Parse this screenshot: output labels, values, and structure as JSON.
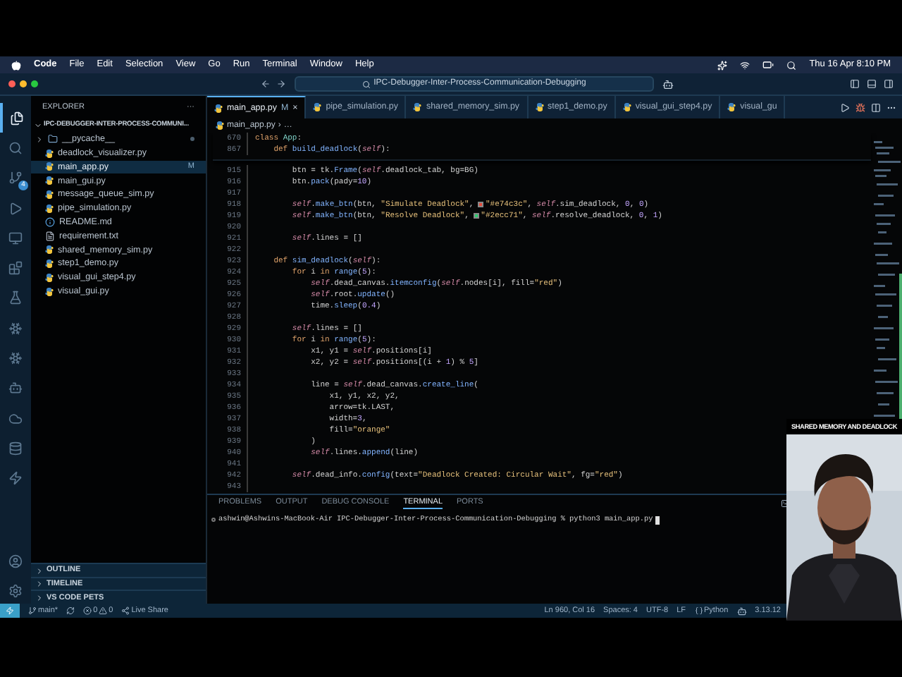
{
  "menu_bar": {
    "app": "Code",
    "items": [
      "File",
      "Edit",
      "Selection",
      "View",
      "Go",
      "Run",
      "Terminal",
      "Window",
      "Help"
    ],
    "clock": "Thu 16 Apr 8:10 PM"
  },
  "title_bar": {
    "search": "IPC-Debugger-Inter-Process-Communication-Debugging"
  },
  "activity_bar": {
    "items": [
      {
        "selected": true
      },
      {
        "selected": false
      },
      {
        "selected": false,
        "badge": "4"
      },
      {
        "selected": false
      },
      {
        "selected": false
      },
      {
        "selected": false
      },
      {
        "selected": false
      },
      {
        "selected": false
      },
      {
        "selected": false
      },
      {
        "selected": false
      },
      {
        "selected": false
      },
      {
        "selected": false
      },
      {
        "selected": false
      }
    ]
  },
  "sidebar": {
    "title": "EXPLORER",
    "more": "···",
    "folder": {
      "name": "IPC-DEBUGGER-INTER-PROCESS-COMMUNI...",
      "expanded": true
    },
    "files": [
      {
        "name": "__pycache__",
        "kind": "folder",
        "selected": false,
        "dot": true
      },
      {
        "name": "deadlock_visualizer.py",
        "kind": "py",
        "selected": false
      },
      {
        "name": "main_app.py",
        "kind": "py",
        "selected": true,
        "badge": "M"
      },
      {
        "name": "main_gui.py",
        "kind": "py",
        "selected": false
      },
      {
        "name": "message_queue_sim.py",
        "kind": "py",
        "selected": false
      },
      {
        "name": "pipe_simulation.py",
        "kind": "py",
        "selected": false
      },
      {
        "name": "README.md",
        "kind": "md",
        "selected": false
      },
      {
        "name": "requirement.txt",
        "kind": "txt",
        "selected": false
      },
      {
        "name": "shared_memory_sim.py",
        "kind": "py",
        "selected": false
      },
      {
        "name": "step1_demo.py",
        "kind": "py",
        "selected": false
      },
      {
        "name": "visual_gui_step4.py",
        "kind": "py",
        "selected": false
      },
      {
        "name": "visual_gui.py",
        "kind": "py",
        "selected": false
      }
    ],
    "sections": [
      "OUTLINE",
      "TIMELINE",
      "VS CODE PETS"
    ]
  },
  "tabs": [
    {
      "label": "main_app.py",
      "selected": true,
      "badge": "M",
      "close": "×"
    },
    {
      "label": "pipe_simulation.py",
      "selected": false
    },
    {
      "label": "shared_memory_sim.py",
      "selected": false
    },
    {
      "label": "step1_demo.py",
      "selected": false
    },
    {
      "label": "visual_gui_step4.py",
      "selected": false
    },
    {
      "label": "visual_gu",
      "selected": false
    }
  ],
  "breadcrumb": {
    "file": "main_app.py",
    "separator": "›",
    "rest": "…"
  },
  "sticky": [
    {
      "num": "670",
      "tokens": [
        {
          "kind": "kw",
          "text": "class "
        },
        {
          "kind": "cls",
          "text": "App"
        },
        {
          "kind": "plain",
          "text": ":"
        }
      ]
    },
    {
      "num": "867",
      "tokens": [
        {
          "kind": "kw",
          "text": "    def "
        },
        {
          "kind": "fn",
          "text": "build_deadlock"
        },
        {
          "kind": "plain",
          "text": "("
        },
        {
          "kind": "self",
          "text": "self"
        },
        {
          "kind": "plain",
          "text": "):"
        }
      ]
    }
  ],
  "code": [
    {
      "num": "915",
      "tokens": [
        {
          "kind": "plain",
          "text": "        btn = tk."
        },
        {
          "kind": "fn",
          "text": "Frame"
        },
        {
          "kind": "plain",
          "text": "("
        },
        {
          "kind": "self",
          "text": "self"
        },
        {
          "kind": "plain",
          "text": ".deadlock_tab, bg=BG)"
        }
      ]
    },
    {
      "num": "916",
      "tokens": [
        {
          "kind": "plain",
          "text": "        btn."
        },
        {
          "kind": "fn",
          "text": "pack"
        },
        {
          "kind": "plain",
          "text": "(pady="
        },
        {
          "kind": "num",
          "text": "10"
        },
        {
          "kind": "plain",
          "text": ")"
        }
      ]
    },
    {
      "num": "917"
    },
    {
      "num": "918",
      "tokens": [
        {
          "kind": "self",
          "text": "        self"
        },
        {
          "kind": "plain",
          "text": "."
        },
        {
          "kind": "fn",
          "text": "make_btn"
        },
        {
          "kind": "plain",
          "text": "(btn, "
        },
        {
          "kind": "str",
          "text": "\"Simulate Deadlock\""
        },
        {
          "kind": "plain",
          "text": ", "
        },
        {
          "kind": "swatch",
          "color": "#e74c3c"
        },
        {
          "kind": "str",
          "text": "\"#e74c3c\""
        },
        {
          "kind": "plain",
          "text": ", "
        },
        {
          "kind": "self",
          "text": "self"
        },
        {
          "kind": "plain",
          "text": ".sim_deadlock, "
        },
        {
          "kind": "num",
          "text": "0"
        },
        {
          "kind": "plain",
          "text": ", "
        },
        {
          "kind": "num",
          "text": "0"
        },
        {
          "kind": "plain",
          "text": ")"
        }
      ]
    },
    {
      "num": "919",
      "tokens": [
        {
          "kind": "self",
          "text": "        self"
        },
        {
          "kind": "plain",
          "text": "."
        },
        {
          "kind": "fn",
          "text": "make_btn"
        },
        {
          "kind": "plain",
          "text": "(btn, "
        },
        {
          "kind": "str",
          "text": "\"Resolve Deadlock\""
        },
        {
          "kind": "plain",
          "text": ", "
        },
        {
          "kind": "swatch",
          "color": "#2ecc71"
        },
        {
          "kind": "str",
          "text": "\"#2ecc71\""
        },
        {
          "kind": "plain",
          "text": ", "
        },
        {
          "kind": "self",
          "text": "self"
        },
        {
          "kind": "plain",
          "text": ".resolve_deadlock, "
        },
        {
          "kind": "num",
          "text": "0"
        },
        {
          "kind": "plain",
          "text": ", "
        },
        {
          "kind": "num",
          "text": "1"
        },
        {
          "kind": "plain",
          "text": ")"
        }
      ]
    },
    {
      "num": "920"
    },
    {
      "num": "921",
      "tokens": [
        {
          "kind": "self",
          "text": "        self"
        },
        {
          "kind": "plain",
          "text": ".lines = []"
        }
      ]
    },
    {
      "num": "922"
    },
    {
      "num": "923",
      "tokens": [
        {
          "kind": "kw",
          "text": "    def "
        },
        {
          "kind": "fn",
          "text": "sim_deadlock"
        },
        {
          "kind": "plain",
          "text": "("
        },
        {
          "kind": "self",
          "text": "self"
        },
        {
          "kind": "plain",
          "text": "):"
        }
      ]
    },
    {
      "num": "924",
      "tokens": [
        {
          "kind": "kw",
          "text": "        for "
        },
        {
          "kind": "plain",
          "text": "i "
        },
        {
          "kind": "kw",
          "text": "in "
        },
        {
          "kind": "fn",
          "text": "range"
        },
        {
          "kind": "plain",
          "text": "("
        },
        {
          "kind": "num",
          "text": "5"
        },
        {
          "kind": "plain",
          "text": "):"
        }
      ]
    },
    {
      "num": "925",
      "tokens": [
        {
          "kind": "self",
          "text": "            self"
        },
        {
          "kind": "plain",
          "text": ".dead_canvas."
        },
        {
          "kind": "fn",
          "text": "itemconfig"
        },
        {
          "kind": "plain",
          "text": "("
        },
        {
          "kind": "self",
          "text": "self"
        },
        {
          "kind": "plain",
          "text": ".nodes[i], fill="
        },
        {
          "kind": "str",
          "text": "\"red\""
        },
        {
          "kind": "plain",
          "text": ")"
        }
      ]
    },
    {
      "num": "926",
      "tokens": [
        {
          "kind": "self",
          "text": "            self"
        },
        {
          "kind": "plain",
          "text": ".root."
        },
        {
          "kind": "fn",
          "text": "update"
        },
        {
          "kind": "plain",
          "text": "()"
        }
      ]
    },
    {
      "num": "927",
      "tokens": [
        {
          "kind": "plain",
          "text": "            time."
        },
        {
          "kind": "fn",
          "text": "sleep"
        },
        {
          "kind": "plain",
          "text": "("
        },
        {
          "kind": "num",
          "text": "0.4"
        },
        {
          "kind": "plain",
          "text": ")"
        }
      ]
    },
    {
      "num": "928"
    },
    {
      "num": "929",
      "tokens": [
        {
          "kind": "self",
          "text": "        self"
        },
        {
          "kind": "plain",
          "text": ".lines = []"
        }
      ]
    },
    {
      "num": "930",
      "tokens": [
        {
          "kind": "kw",
          "text": "        for "
        },
        {
          "kind": "plain",
          "text": "i "
        },
        {
          "kind": "kw",
          "text": "in "
        },
        {
          "kind": "fn",
          "text": "range"
        },
        {
          "kind": "plain",
          "text": "("
        },
        {
          "kind": "num",
          "text": "5"
        },
        {
          "kind": "plain",
          "text": "):"
        }
      ]
    },
    {
      "num": "931",
      "tokens": [
        {
          "kind": "plain",
          "text": "            x1, y1 = "
        },
        {
          "kind": "self",
          "text": "self"
        },
        {
          "kind": "plain",
          "text": ".positions[i]"
        }
      ]
    },
    {
      "num": "932",
      "tokens": [
        {
          "kind": "plain",
          "text": "            x2, y2 = "
        },
        {
          "kind": "self",
          "text": "self"
        },
        {
          "kind": "plain",
          "text": ".positions[(i + "
        },
        {
          "kind": "num",
          "text": "1"
        },
        {
          "kind": "plain",
          "text": ") % "
        },
        {
          "kind": "num",
          "text": "5"
        },
        {
          "kind": "plain",
          "text": "]"
        }
      ]
    },
    {
      "num": "933"
    },
    {
      "num": "934",
      "tokens": [
        {
          "kind": "plain",
          "text": "            line = "
        },
        {
          "kind": "self",
          "text": "self"
        },
        {
          "kind": "plain",
          "text": ".dead_canvas."
        },
        {
          "kind": "fn",
          "text": "create_line"
        },
        {
          "kind": "plain",
          "text": "("
        }
      ]
    },
    {
      "num": "935",
      "tokens": [
        {
          "kind": "plain",
          "text": "                x1, y1, x2, y2,"
        }
      ]
    },
    {
      "num": "936",
      "tokens": [
        {
          "kind": "plain",
          "text": "                arrow=tk.LAST,"
        }
      ]
    },
    {
      "num": "937",
      "tokens": [
        {
          "kind": "plain",
          "text": "                width="
        },
        {
          "kind": "num",
          "text": "3"
        },
        {
          "kind": "plain",
          "text": ","
        }
      ]
    },
    {
      "num": "938",
      "tokens": [
        {
          "kind": "plain",
          "text": "                fill="
        },
        {
          "kind": "str",
          "text": "\"orange\""
        }
      ]
    },
    {
      "num": "939",
      "tokens": [
        {
          "kind": "plain",
          "text": "            )"
        }
      ]
    },
    {
      "num": "940",
      "tokens": [
        {
          "kind": "self",
          "text": "            self"
        },
        {
          "kind": "plain",
          "text": ".lines."
        },
        {
          "kind": "fn",
          "text": "append"
        },
        {
          "kind": "plain",
          "text": "(line)"
        }
      ]
    },
    {
      "num": "941"
    },
    {
      "num": "942",
      "tokens": [
        {
          "kind": "self",
          "text": "        self"
        },
        {
          "kind": "plain",
          "text": ".dead_info."
        },
        {
          "kind": "fn",
          "text": "config"
        },
        {
          "kind": "plain",
          "text": "(text="
        },
        {
          "kind": "str",
          "text": "\"Deadlock Created: Circular Wait\""
        },
        {
          "kind": "plain",
          "text": ", fg="
        },
        {
          "kind": "str",
          "text": "\"red\""
        },
        {
          "kind": "plain",
          "text": ")"
        }
      ]
    },
    {
      "num": "943"
    }
  ],
  "panel": {
    "tabs": [
      {
        "label": "PROBLEMS",
        "selected": false
      },
      {
        "label": "OUTPUT",
        "selected": false
      },
      {
        "label": "DEBUG CONSOLE",
        "selected": false
      },
      {
        "label": "TERMINAL",
        "selected": true
      },
      {
        "label": "PORTS",
        "selected": false
      }
    ],
    "terminal": "ashwin@Ashwins-MacBook-Air IPC-Debugger-Inter-Process-Communication-Debugging % python3 main_app.py"
  },
  "status_bar": {
    "branch": "main*",
    "errors": "0",
    "warnings": "0",
    "live_share": "Live Share",
    "right": [
      "Ln 960, Col 16",
      "Spaces: 4",
      "UTF-8",
      "LF"
    ],
    "language": "Python",
    "version": "3.13.12"
  },
  "overlay": {
    "caption": "SHARED MEMORY AND DEADLOCK",
    "kind": "picture"
  }
}
